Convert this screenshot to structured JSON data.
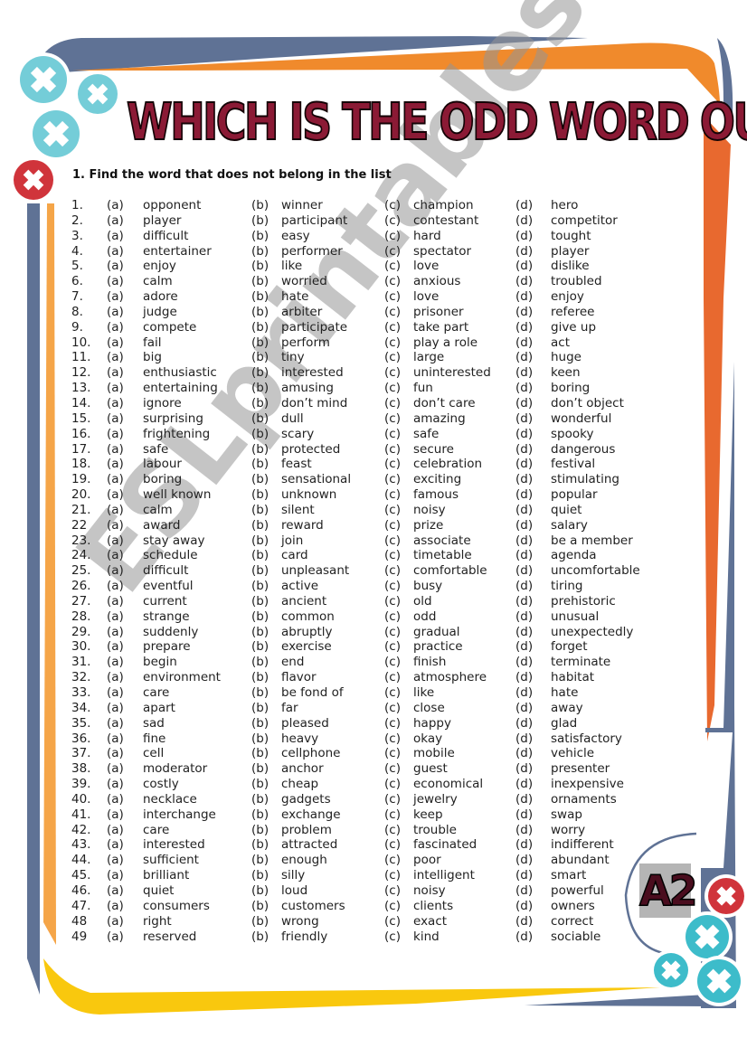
{
  "title": "WHICH IS THE ODD WORD OUT?",
  "instruction": "1.  Find the word that does not belong in the list",
  "level_badge": "A2",
  "watermark": "ESLprintables.com",
  "colors": {
    "title_fill": "#8b1a35",
    "title_outline": "#140306",
    "frame_blue": "#5f7295",
    "frame_orange": "#f08a2c",
    "frame_dark_orange": "#e8692f",
    "frame_yellow": "#f9c80e",
    "circle_teal": "#4fc0cf",
    "circle_red": "#d0343b"
  },
  "option_labels": [
    "(a)",
    "(b)",
    "(c)",
    "(d)"
  ],
  "items": [
    {
      "num": "1.",
      "a": "opponent",
      "b": "winner",
      "c": "champion",
      "d": "hero"
    },
    {
      "num": "2.",
      "a": "player",
      "b": "participant",
      "c": "contestant",
      "d": "competitor"
    },
    {
      "num": "3.",
      "a": "difficult",
      "b": "easy",
      "c": "hard",
      "d": "tought"
    },
    {
      "num": "4.",
      "a": "entertainer",
      "b": "performer",
      "c": "spectator",
      "d": "player"
    },
    {
      "num": "5.",
      "a": "enjoy",
      "b": "like",
      "c": "love",
      "d": "dislike"
    },
    {
      "num": "6.",
      "a": "calm",
      "b": "worried",
      "c": "anxious",
      "d": "troubled"
    },
    {
      "num": "7.",
      "a": "adore",
      "b": "hate",
      "c": "love",
      "d": "enjoy"
    },
    {
      "num": "8.",
      "a": "judge",
      "b": "arbiter",
      "c": "prisoner",
      "d": "referee"
    },
    {
      "num": "9.",
      "a": "compete",
      "b": "participate",
      "c": "take part",
      "d": "give up"
    },
    {
      "num": "10.",
      "a": "fail",
      "b": "perform",
      "c": "play a role",
      "d": "act"
    },
    {
      "num": "11.",
      "a": "big",
      "b": "tiny",
      "c": "large",
      "d": "huge"
    },
    {
      "num": "12.",
      "a": "enthusiastic",
      "b": "interested",
      "c": "uninterested",
      "d": "keen"
    },
    {
      "num": "13.",
      "a": "entertaining",
      "b": "amusing",
      "c": "fun",
      "d": "boring"
    },
    {
      "num": "14.",
      "a": "ignore",
      "b": "don’t mind",
      "c": "don’t care",
      "d": "don’t object"
    },
    {
      "num": "15.",
      "a": "surprising",
      "b": "dull",
      "c": "amazing",
      "d": "wonderful"
    },
    {
      "num": "16.",
      "a": "frightening",
      "b": "scary",
      "c": "safe",
      "d": "spooky"
    },
    {
      "num": "17.",
      "a": "safe",
      "b": "protected",
      "c": "secure",
      "d": "dangerous"
    },
    {
      "num": "18.",
      "a": "labour",
      "b": "feast",
      "c": "celebration",
      "d": "festival"
    },
    {
      "num": "19.",
      "a": "boring",
      "b": "sensational",
      "c": "exciting",
      "d": "stimulating"
    },
    {
      "num": "20.",
      "a": "well known",
      "b": "unknown",
      "c": "famous",
      "d": "popular"
    },
    {
      "num": "21.",
      "a": "calm",
      "b": "silent",
      "c": "noisy",
      "d": "quiet"
    },
    {
      "num": "22",
      "a": "award",
      "b": "reward",
      "c": "prize",
      "d": "salary"
    },
    {
      "num": "23.",
      "a": "stay away",
      "b": "join",
      "c": "associate",
      "d": "be a member"
    },
    {
      "num": "24.",
      "a": "schedule",
      "b": "card",
      "c": "timetable",
      "d": "agenda"
    },
    {
      "num": "25.",
      "a": "difficult",
      "b": "unpleasant",
      "c": "comfortable",
      "d": "uncomfortable"
    },
    {
      "num": "26.",
      "a": "eventful",
      "b": "active",
      "c": "busy",
      "d": "tiring"
    },
    {
      "num": "27.",
      "a": "current",
      "b": "ancient",
      "c": "old",
      "d": "prehistoric"
    },
    {
      "num": "28.",
      "a": "strange",
      "b": "common",
      "c": "odd",
      "d": "unusual"
    },
    {
      "num": "29.",
      "a": "suddenly",
      "b": "abruptly",
      "c": "gradual",
      "d": "unexpectedly"
    },
    {
      "num": "30.",
      "a": "prepare",
      "b": "exercise",
      "c": "practice",
      "d": "forget"
    },
    {
      "num": "31.",
      "a": "begin",
      "b": "end",
      "c": "finish",
      "d": "terminate"
    },
    {
      "num": "32.",
      "a": "environment",
      "b": "flavor",
      "c": "atmosphere",
      "d": "habitat"
    },
    {
      "num": "33.",
      "a": "care",
      "b": "be fond of",
      "c": "like",
      "d": "hate"
    },
    {
      "num": "34.",
      "a": "apart",
      "b": "far",
      "c": "close",
      "d": "away"
    },
    {
      "num": "35.",
      "a": "sad",
      "b": "pleased",
      "c": "happy",
      "d": "glad"
    },
    {
      "num": "36.",
      "a": "fine",
      "b": "heavy",
      "c": "okay",
      "d": "satisfactory"
    },
    {
      "num": "37.",
      "a": "cell",
      "b": "cellphone",
      "c": "mobile",
      "d": "vehicle"
    },
    {
      "num": "38.",
      "a": "moderator",
      "b": "anchor",
      "c": "guest",
      "d": "presenter"
    },
    {
      "num": "39.",
      "a": "costly",
      "b": "cheap",
      "c": "economical",
      "d": "inexpensive"
    },
    {
      "num": "40.",
      "a": "necklace",
      "b": "gadgets",
      "c": "jewelry",
      "d": "ornaments"
    },
    {
      "num": "41.",
      "a": "interchange",
      "b": "exchange",
      "c": "keep",
      "d": "swap"
    },
    {
      "num": "42.",
      "a": "care",
      "b": "problem",
      "c": "trouble",
      "d": "worry"
    },
    {
      "num": "43.",
      "a": "interested",
      "b": "attracted",
      "c": "fascinated",
      "d": "indifferent"
    },
    {
      "num": "44.",
      "a": "sufficient",
      "b": "enough",
      "c": "poor",
      "d": "abundant"
    },
    {
      "num": "45.",
      "a": "brilliant",
      "b": "silly",
      "c": "intelligent",
      "d": "smart"
    },
    {
      "num": "46.",
      "a": "quiet",
      "b": "loud",
      "c": "noisy",
      "d": "powerful"
    },
    {
      "num": "47.",
      "a": "consumers",
      "b": "customers",
      "c": "clients",
      "d": "owners"
    },
    {
      "num": "48",
      "a": "right",
      "b": "wrong",
      "c": "exact",
      "d": "correct"
    },
    {
      "num": "49",
      "a": "reserved",
      "b": "friendly",
      "c": "kind",
      "d": "sociable"
    }
  ]
}
